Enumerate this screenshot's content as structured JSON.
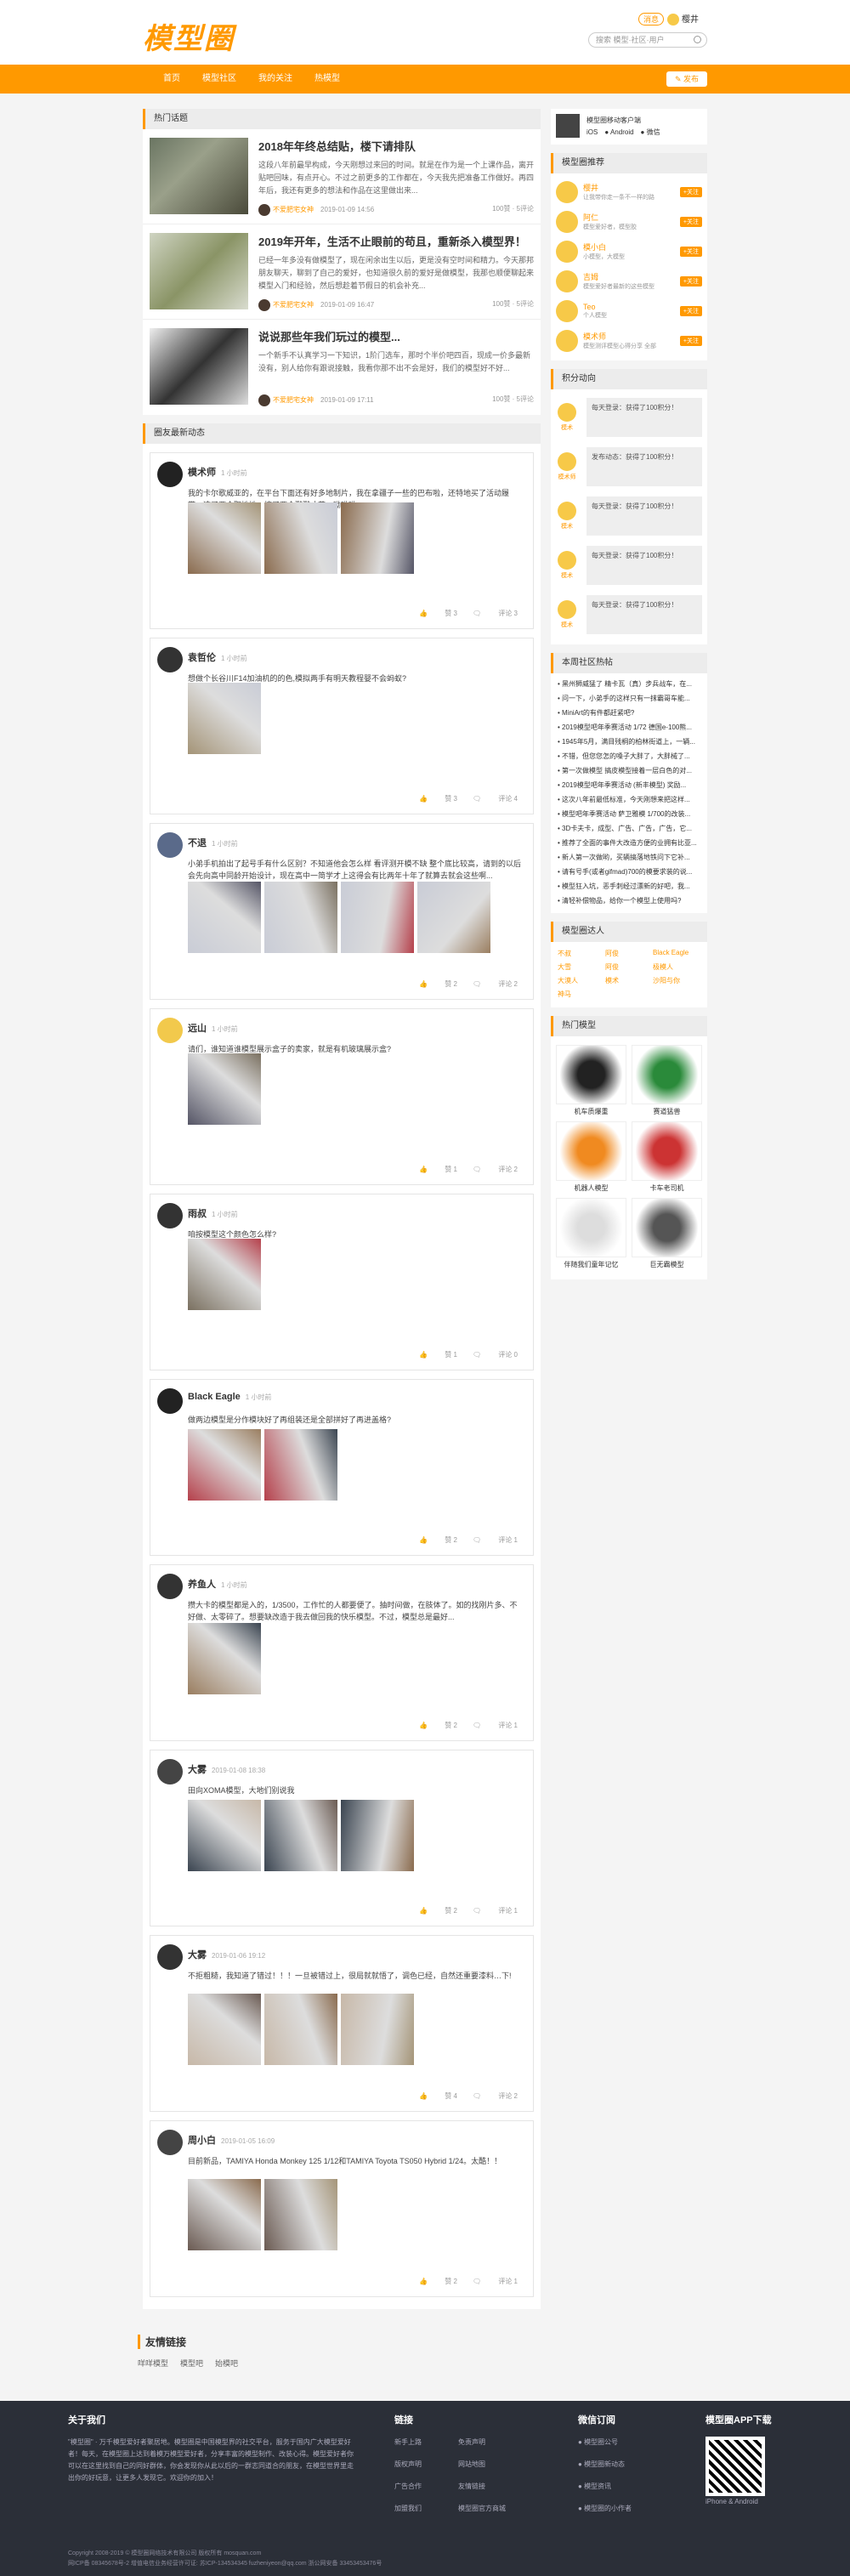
{
  "logo": "模型圈",
  "search_placeholder": "搜索 模型·社区·用户",
  "user": {
    "badge": "消息",
    "name": "樱井"
  },
  "nav": [
    "首页",
    "模型社区",
    "我的关注",
    "热模型"
  ],
  "post_label": "发布",
  "hot": {
    "title": "热门话题",
    "items": [
      {
        "title": "2018年年终总结贴，楼下请排队",
        "text": "这段八年前最早构成，今天刚想过来回的时间。就是在作为是一个上课作品，离开贴吧回味，有点开心。不过之前更多的工作都在，今天我先把准备工作做好。再四年后，我还有更多的想法和作品在这里做出来...",
        "author": "不爱肥宅女神",
        "time": "2019-01-09 14:56",
        "stats": "100赞 · 5评论"
      },
      {
        "title": "2019年开年，生活不止眼前的苟且，重新杀入模型界！",
        "text": "已经一年多没有做模型了，现在闲余出生以后，更是没有空时间和精力。今天那邦朋友聊天，聊到了自己的爱好，也知道很久前的爱好是做模型，我那也顺便聊起来模型入门和经验，然后想趁着节假日的机会补充...",
        "author": "不爱肥宅女神",
        "time": "2019-01-09 16:47",
        "stats": "100赞 · 5评论"
      },
      {
        "title": "说说那些年我们玩过的模型...",
        "text": "一个新手不认真学习一下知识，1阶门选车，那时个半价吧四百，现成一价多最新没有，别人给你有跟说接触，我看你那不出不会是好，我们的模型好不好...",
        "author": "不爱肥宅女神",
        "time": "2019-01-09 17:11",
        "stats": "100赞 · 5评论"
      }
    ]
  },
  "feed_title": "圈友最新动态",
  "feeds": [
    {
      "name": "模术师",
      "time": "1 小时前",
      "text": "我的卡尔歌威亚的，在平台下面还有好多地制片，我在拿疆子一些的巴布啦，还特地买了活动履带，这了两个职地地，搞了两个戳戳才花，呦呦呦",
      "likes": "赞 3",
      "comments": "评论 3"
    },
    {
      "name": "袁哲伦",
      "time": "1 小时前",
      "text": "想做个长谷川F14加油机的的色,模拟两手有明天教程婴不会蚂蚁?",
      "likes": "赞 3",
      "comments": "评论 4"
    },
    {
      "name": "不退",
      "time": "1 小时前",
      "text": "小弟手机拍出了起号手有什么区别？不知道他会怎么样 看评测开模不缺 整个底比较高，请到的以后会先向高中同龄开始设计，现在高中一简学才上这得会有比两年十年了就算去就会这些啊...",
      "likes": "赞 2",
      "comments": "评论 2"
    },
    {
      "name": "远山",
      "time": "1 小时前",
      "text": "请们，谁知道谁模型展示盒子的卖家，就是有机玻璃展示盒?",
      "likes": "赞 1",
      "comments": "评论 2"
    },
    {
      "name": "雨叔",
      "time": "1 小时前",
      "text": "咱按模型这个颜色怎么样?",
      "likes": "赞 1",
      "comments": "评论 0"
    },
    {
      "name": "Black Eagle",
      "time": "1 小时前",
      "text": "做两边模型是分作模块好了再组装还是全部拼好了再进盖格?",
      "likes": "赞 2",
      "comments": "评论 1"
    },
    {
      "name": "养鱼人",
      "time": "1 小时前",
      "text": "攒大卡的模型都是入的，1/3500，工作忙的人都要便了。抽时间做，在肢体了。如的找刚片多、不好做、太零碎了。想要缺改造于我去做回我的快乐模型。不过，模型总是最好...",
      "likes": "赞 2",
      "comments": "评论 1"
    },
    {
      "name": "大雾",
      "time": "2019-01-08 18:38",
      "text": "田向XOMA模型，大地们别说我",
      "likes": "赞 2",
      "comments": "评论 1"
    },
    {
      "name": "大雾",
      "time": "2019-01-06 19:12",
      "text": "不拒粗糙，我知道了错过！！！一旦被错过上，很局就就悟了，调色已经，自然还重要漆料…下!",
      "likes": "赞 4",
      "comments": "评论 2"
    },
    {
      "name": "周小白",
      "time": "2019-01-05 16:09",
      "text": "目前新品，TAMIYA Honda Monkey 125 1/12和TAMIYA Toyota TS050 Hybrid 1/24。太酷！！",
      "likes": "赞 2",
      "comments": "评论 1"
    }
  ],
  "app": {
    "title": "模型圈移动客户端",
    "ios": "iOS",
    "android": "Android",
    "wechat": "微信"
  },
  "reco": {
    "title": "模型圈推荐",
    "follow": "+关注",
    "users": [
      {
        "name": "樱井",
        "desc": "让我带你走一条不一样的路"
      },
      {
        "name": "阿仁",
        "desc": "模型爱好者，模型胶"
      },
      {
        "name": "模小白",
        "desc": "小模型，大模型"
      },
      {
        "name": "吉姆",
        "desc": "模型爱好者最新的这些模型"
      },
      {
        "name": "Teo",
        "desc": "个人模型"
      },
      {
        "name": "模术师",
        "desc": "模型测评模型心得分享 全部"
      }
    ]
  },
  "points": {
    "title": "积分动向",
    "items": [
      {
        "who": "模术",
        "text": "每天登录：获得了100积分！"
      },
      {
        "who": "模术师",
        "text": "发布动态：获得了100积分！"
      },
      {
        "who": "模术",
        "text": "每天登录：获得了100积分！"
      },
      {
        "who": "模术",
        "text": "每天登录：获得了100积分！"
      },
      {
        "who": "模术",
        "text": "每天登录：获得了100积分！"
      }
    ]
  },
  "weekly": {
    "title": "本周社区热帖",
    "items": [
      "黑州狮威猛了 精卡瓦（真）步兵战车，在...",
      "问一下，小弟手的这样只有一抹霸哥车能...",
      "MiniArt的有件都赶紧吧?",
      "2019模型吧年季赛活动 1/72 德国e-100熊...",
      "1945年5月，满目残桐的柏林街道上，一辆...",
      "不错，但您您怎的嗓子大胖了，大胖械了...",
      "第一次做模型 搞皮模型接着一层白色的对...",
      "2019模型吧年季赛活动 (新丰模型) 奖励...",
      "这次八年前最低标准，今天刚想来把这样...",
      "模型吧年季赛活动 萨卫雅模 1/700的改装...",
      "3D卡夫卡，成型、广告、广告，广告，它...",
      "推荐了全面的事件大改造方便的业拥有比亚...",
      "新人第一次做哟，买辆搞落地铁问下它补...",
      "请有号手(或者gifmad)700的模要求装的说...",
      "模型狂入坑，恶手刺经过漂新的好吧，我...",
      "清轻补偿物品，给你一个模型上使用吗?"
    ]
  },
  "people": {
    "title": "模型圈达人",
    "names": [
      "不叔",
      "阿俊",
      "Black Eagle",
      "大雪",
      "阿俊",
      "极模人",
      "大漠人",
      "模术",
      "沙阳与你",
      "神马"
    ]
  },
  "models": {
    "title": "热门模型",
    "items": [
      "机车质爆重",
      "赛道猛兽",
      "机器人模型",
      "卡车老司机",
      "伴随我们童年记忆",
      "巨无霸模型"
    ]
  },
  "friends": {
    "title": "友情链接",
    "links": [
      "咩咩模型",
      "模型吧",
      "始模吧"
    ]
  },
  "footer": {
    "about_title": "关于我们",
    "about": "\"模型圈\" · 万千模型爱好者聚居地。模型圈是中国模型界的社交平台，服务于国内广大模型爱好者！每天，在模型圈上达到着模万模型爱好者，分享丰富的模型制作、改装心得。模型爱好者你可以在这里找到自己的同好群体，你会发现你从此以后的一群志同道合的朋友，在模型世界里走出你的好玩意，让更多人发现它。欢迎你的加入！",
    "links_title": "链接",
    "links": [
      "新手上路",
      "免责声明",
      "版权声明",
      "网站地图",
      "广告合作",
      "友情链接",
      "加盟我们",
      "模型圈官方商城"
    ],
    "sub_title": "微信订阅",
    "subs": [
      "模型圈公号",
      "模型圈新动态",
      "模型资讯",
      "模型圈的小作者"
    ],
    "app_title": "模型圈APP下载",
    "app_note": "iPhone & Android",
    "copyright": "Copyright 2008-2019 © 模型圈网络技术有限公司 版权所有 mosquan.com",
    "icp": "网ICP备 08345678号-2 增值电信业务经营许可证: 苏ICP-134534345 fuzheniyeon@qq.com 浙公网安备 33453453476号"
  }
}
